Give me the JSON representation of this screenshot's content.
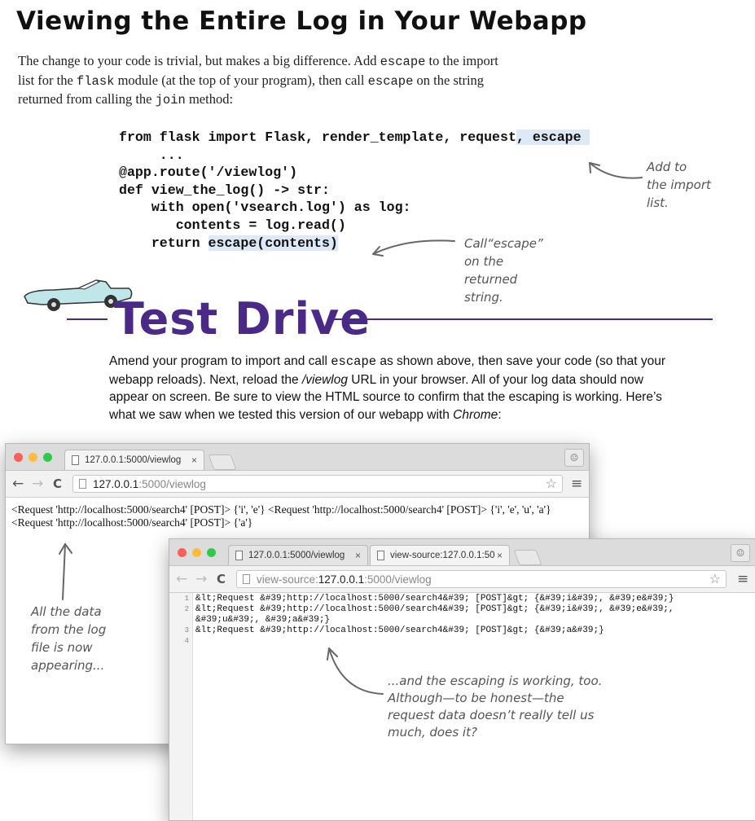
{
  "heading": "Viewing the Entire Log in Your Webapp",
  "intro": {
    "t1": "The change to your code is trivial, but makes a big difference. Add ",
    "c1": "escape",
    "t2": " to the import list for the ",
    "c2": "flask",
    "t3": " module (at the top of your program), then call ",
    "c3": "escape",
    "t4": " on the string returned from calling the ",
    "c4": "join",
    "t5": " method:"
  },
  "code": {
    "l1a": "from flask import Flask, render_template, request",
    "l1b": ", escape ",
    "l2": "     ...",
    "l3": "@app.route('/viewlog')",
    "l4": "def view_the_log() -> str:",
    "l5": "    with open('vsearch.log') as log:",
    "l6": "       contents = log.read()",
    "l7a": "    return ",
    "l7b": "escape(contents)"
  },
  "notes": {
    "add_import": [
      "Add to",
      "the import",
      "list."
    ],
    "call_escape": [
      "Call“escape”",
      "on the",
      "returned",
      "string."
    ],
    "log_appearing": [
      "All the data",
      "from the log",
      "file is now",
      "appearing..."
    ],
    "escaping_working": [
      "...and the escaping is working, too.",
      "Although—to be honest—the",
      "request data doesn’t really tell us",
      "much, does it?"
    ]
  },
  "test_drive": {
    "title": "Test Drive",
    "p1": "Amend your program to import and call ",
    "code": "escape",
    "p2": " as shown above, then save your code (so that your webapp reloads). Next, reload the ",
    "url": "/viewlog",
    "p3": " URL in your browser. All of your log data should now appear on screen. Be sure to view the HTML source to confirm that the escaping is working. Here’s what we saw when we tested this version of our webapp with ",
    "browser": "Chrome",
    "p4": ":"
  },
  "browser1": {
    "tab_title": "127.0.0.1:5000/viewlog",
    "url_host": "127.0.0.1",
    "url_path": ":5000/viewlog",
    "content": "<Request 'http://localhost:5000/search4' [POST]> {'i', 'e'} <Request 'http://localhost:5000/search4' [POST]> {'i', 'e', 'u', 'a'} <Request 'http://localhost:5000/search4' [POST]> {'a'}"
  },
  "browser2": {
    "tab1_title": "127.0.0.1:5000/viewlog",
    "tab2_title": "view-source:127.0.0.1:50",
    "url_prefix": "view-source:",
    "url_host": "127.0.0.1",
    "url_path": ":5000/viewlog",
    "line_numbers": [
      "1",
      "2",
      "",
      "3",
      "4"
    ],
    "source_lines": [
      "&lt;Request &#39;http://localhost:5000/search4&#39; [POST]&gt; {&#39;i&#39;, &#39;e&#39;}",
      "&lt;Request &#39;http://localhost:5000/search4&#39; [POST]&gt; {&#39;i&#39;, &#39;e&#39;,",
      "&#39;u&#39;, &#39;a&#39;}",
      "&lt;Request &#39;http://localhost:5000/search4&#39; [POST]&gt; {&#39;a&#39;}",
      ""
    ]
  },
  "icons": {
    "close": "×",
    "back": "←",
    "forward": "→",
    "reload": "C",
    "star": "☆",
    "menu": "≡",
    "user": "☺"
  },
  "colors": {
    "accent_purple": "#4a2a86",
    "code_highlight": "#dde9f6",
    "traffic_red": "#fc605c",
    "traffic_yellow": "#fdbc40",
    "traffic_green": "#34c84a"
  }
}
